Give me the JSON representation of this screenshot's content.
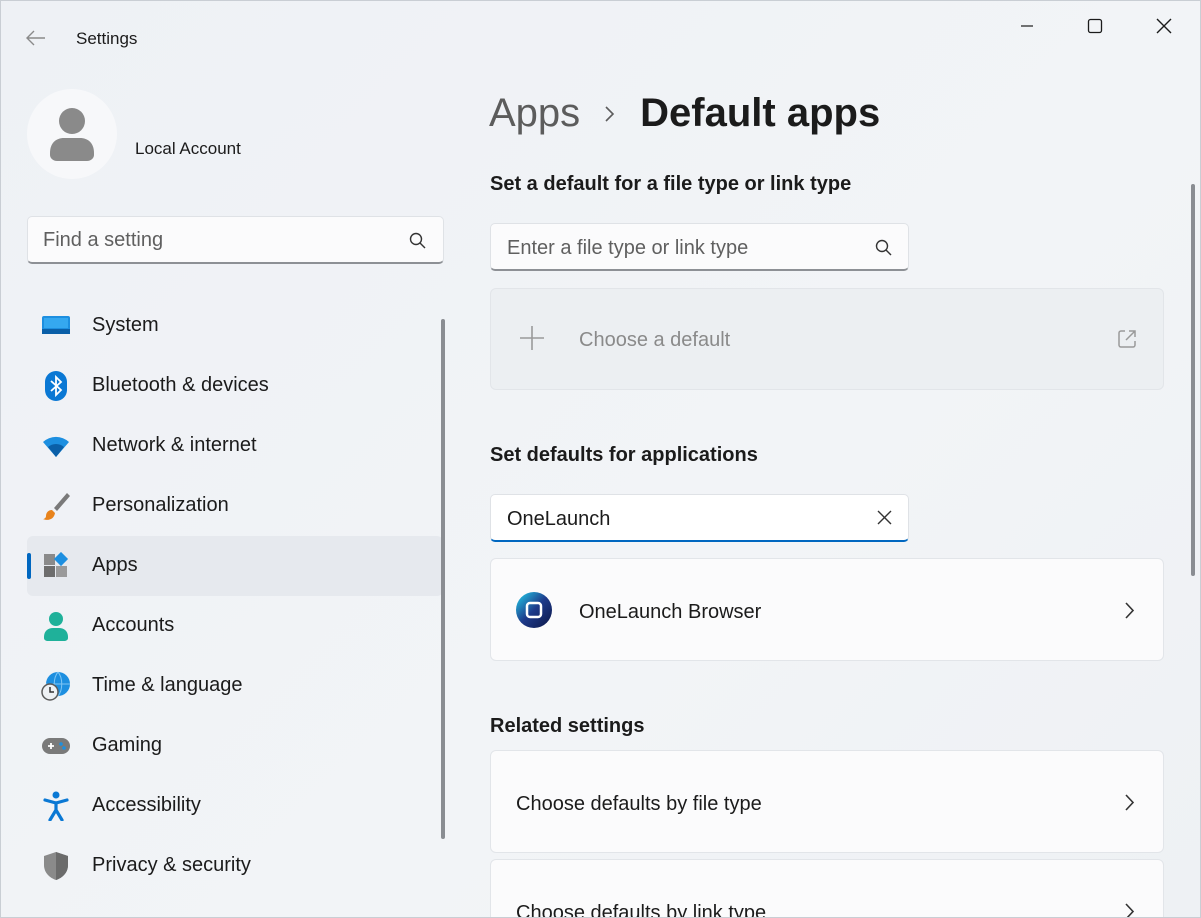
{
  "window": {
    "title": "Settings",
    "controls": {
      "minimize": "minimize-icon",
      "maximize": "maximize-icon",
      "close": "close-icon"
    }
  },
  "profile": {
    "name": "Local Account"
  },
  "sidebar": {
    "search_placeholder": "Find a setting",
    "items": [
      {
        "label": "System",
        "icon": "system-monitor-icon",
        "selected": false
      },
      {
        "label": "Bluetooth & devices",
        "icon": "bluetooth-icon",
        "selected": false
      },
      {
        "label": "Network & internet",
        "icon": "wifi-icon",
        "selected": false
      },
      {
        "label": "Personalization",
        "icon": "paintbrush-icon",
        "selected": false
      },
      {
        "label": "Apps",
        "icon": "apps-icon",
        "selected": true
      },
      {
        "label": "Accounts",
        "icon": "accounts-icon",
        "selected": false
      },
      {
        "label": "Time & language",
        "icon": "globe-clock-icon",
        "selected": false
      },
      {
        "label": "Gaming",
        "icon": "gamepad-icon",
        "selected": false
      },
      {
        "label": "Accessibility",
        "icon": "accessibility-icon",
        "selected": false
      },
      {
        "label": "Privacy & security",
        "icon": "shield-icon",
        "selected": false
      }
    ]
  },
  "breadcrumb": {
    "parent": "Apps",
    "current": "Default apps"
  },
  "file_type_section": {
    "title": "Set a default for a file type or link type",
    "search_placeholder": "Enter a file type or link type",
    "choose_default_label": "Choose a default"
  },
  "apps_section": {
    "title": "Set defaults for applications",
    "search_value": "OneLaunch",
    "results": [
      {
        "name": "OneLaunch Browser"
      }
    ]
  },
  "related": {
    "title": "Related settings",
    "items": [
      {
        "label": "Choose defaults by file type"
      },
      {
        "label": "Choose defaults by link type"
      }
    ]
  },
  "colors": {
    "accent": "#0067c0",
    "background": "#eef2f6"
  }
}
